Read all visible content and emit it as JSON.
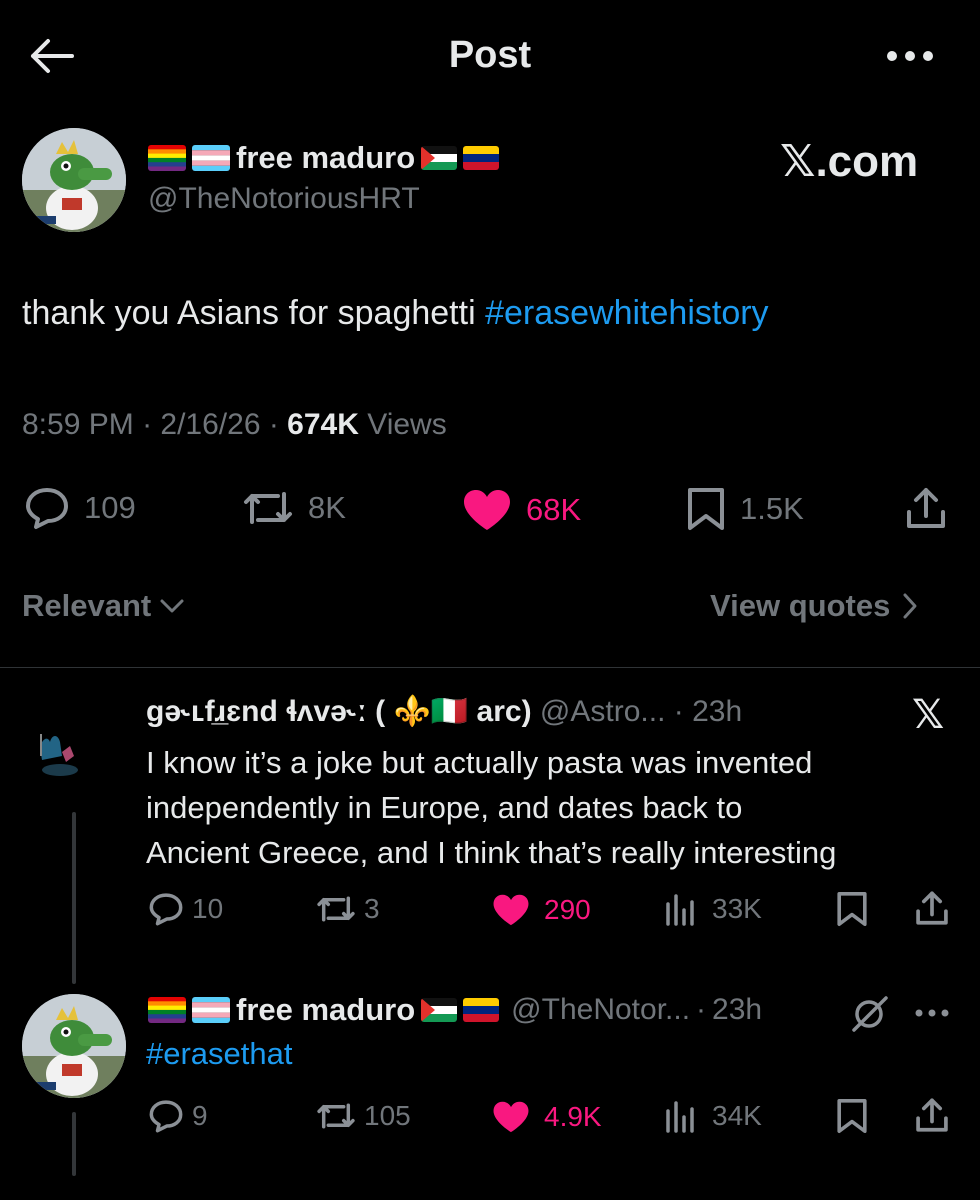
{
  "topbar": {
    "title": "Post",
    "back_icon": "arrow-left-icon",
    "more_icon": "more-horizontal-icon"
  },
  "post": {
    "display_name": "free maduro",
    "handle": "@TheNotoriousHRT",
    "watermark": "𝕏.com",
    "text_plain": "thank you Asians for spaghetti ",
    "text_hashtag": "#erasewhitehistory",
    "time": "8:59 PM",
    "date": "2/16/26",
    "views_count": "674K",
    "views_label": "Views",
    "stats": {
      "replies": "109",
      "reposts": "8K",
      "likes": "68K",
      "bookmarks": "1.5K"
    }
  },
  "sort": {
    "label": "Relevant",
    "view_quotes": "View quotes"
  },
  "replies": [
    {
      "display_name": "gə˞ʟfɹ̲ɛnd ɬʌvə˞ː ( ⚜️🇮🇹 arc)",
      "handle": "@Astro...",
      "age": "23h",
      "badge": "𝕏",
      "lines": [
        "I know it’s a joke but actually pasta was invented",
        "independently in Europe, and dates back to",
        "Ancient Greece, and I think that’s really interesting"
      ],
      "stats": {
        "replies": "10",
        "reposts": "3",
        "likes": "290",
        "views": "33K"
      }
    },
    {
      "display_name": "free maduro",
      "handle": "@TheNotor...",
      "age": "23h",
      "text_hashtag": "#erasethat",
      "stats": {
        "replies": "9",
        "reposts": "105",
        "likes": "4.9K",
        "views": "34K"
      }
    }
  ],
  "colors": {
    "background": "#000000",
    "text": "#e7e9ea",
    "muted": "#71767b",
    "link": "#1d9bf0",
    "like": "#f91880",
    "divider": "#2f3336"
  }
}
